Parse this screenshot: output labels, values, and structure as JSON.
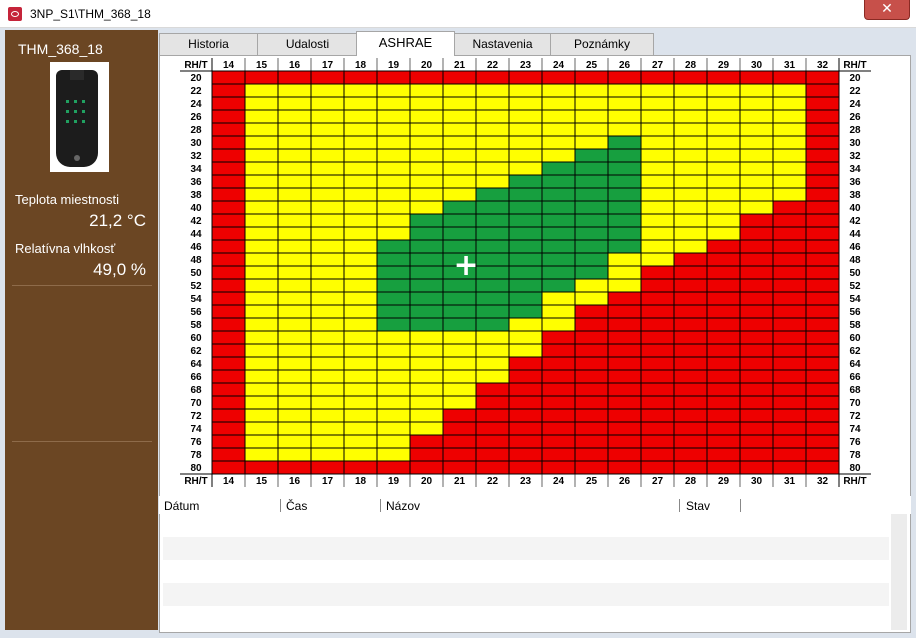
{
  "window": {
    "title": "3NP_S1\\THM_368_18",
    "close_label": "✕"
  },
  "sidebar": {
    "device_name": "THM_368_18",
    "temperature_label": "Teplota miestnosti",
    "temperature_value": "21,2 °C",
    "humidity_label": "Relatívna vlhkosť",
    "humidity_value": "49,0 %"
  },
  "tabs": [
    {
      "label": "Historia",
      "active": false
    },
    {
      "label": "Udalosti",
      "active": false
    },
    {
      "label": "ASHRAE",
      "active": true
    },
    {
      "label": "Nastavenia",
      "active": false
    },
    {
      "label": "Poznámky",
      "active": false
    }
  ],
  "colors": {
    "red": "#ee0000",
    "yellow": "#ffff00",
    "green": "#179f3f",
    "sidebar": "#6b4623",
    "marker": "#ffffff"
  },
  "chart_data": {
    "type": "heatmap",
    "corner_label": "RH/T",
    "x_label_unit": "T",
    "y_label_unit": "RH",
    "x": [
      14,
      15,
      16,
      17,
      18,
      19,
      20,
      21,
      22,
      23,
      24,
      25,
      26,
      27,
      28,
      29,
      30,
      31,
      32
    ],
    "y": [
      20,
      22,
      24,
      26,
      28,
      30,
      32,
      34,
      36,
      38,
      40,
      42,
      44,
      46,
      48,
      50,
      52,
      54,
      56,
      58,
      60,
      62,
      64,
      66,
      68,
      70,
      72,
      74,
      76,
      78,
      80
    ],
    "legend": {
      "R": "red",
      "Y": "yellow",
      "G": "green"
    },
    "rows": [
      "RRRRRRRRRRRRRRRRRRR",
      "RYYYYYYYYYYYYYYYYYR",
      "RYYYYYYYYYYYYYYYYYR",
      "RYYYYYYYYYYYYYYYYYR",
      "RYYYYYYYYYYYYYYYYYR",
      "RYYYYYYYYYYYGYYYYYR",
      "RYYYYYYYYYYGGYYYYYR",
      "RYYYYYYYYYGGGYYYYYR",
      "RYYYYYYYYGGGGYYYYYR",
      "RYYYYYYYGGGGGYYYYYR",
      "RYYYYYYGGGGGGYYYYRR",
      "RYYYYYGGGGGGGYYYRRR",
      "RYYYYYGGGGGGGYYYRRR",
      "RYYYYGGGGGGGGYYRRRR",
      "RYYYYGGGGGGGYYRRRRR",
      "RYYYYGGGGGGGYRRRRRR",
      "RYYYYGGGGGGYYRRRRRR",
      "RYYYYGGGGGYYRRRRRRR",
      "RYYYYGGGGGYRRRRRRRR",
      "RYYYYGGGGYYRRRRRRRR",
      "RYYYYYYYYYRRRRRRRRR",
      "RYYYYYYYYYRRRRRRRRR",
      "RYYYYYYYYRRRRRRRRRR",
      "RYYYYYYYYRRRRRRRRRR",
      "RYYYYYYYRRRRRRRRRRR",
      "RYYYYYYYRRRRRRRRRRR",
      "RYYYYYYRRRRRRRRRRRR",
      "RYYYYYYRRRRRRRRRRRR",
      "RYYYYYRRRRRRRRRRRRR",
      "RYYYYYRRRRRRRRRRRRR",
      "RRRRRRRRRRRRRRRRRRR"
    ],
    "marker": {
      "x": 21.2,
      "y": 49.0,
      "symbol": "+"
    },
    "grid": true
  },
  "events_table": {
    "columns": [
      "Dátum",
      "Čas",
      "Názov",
      "Stav"
    ],
    "rows": []
  }
}
